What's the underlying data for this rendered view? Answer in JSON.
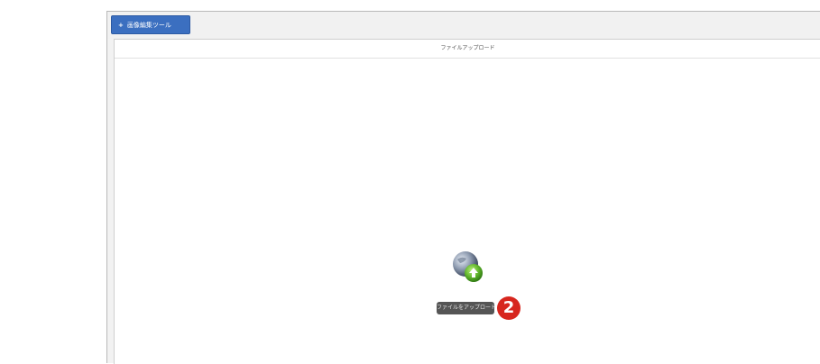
{
  "toolbar": {
    "tab_plus": "+",
    "tab_label": "画像編集ツール"
  },
  "panel": {
    "title": "ファイルアップロード"
  },
  "upload": {
    "icon": "globe-upload-icon",
    "button_label": "ファイルをアップロード"
  },
  "annotation": {
    "step_number": "2",
    "color": "#d7261e"
  }
}
